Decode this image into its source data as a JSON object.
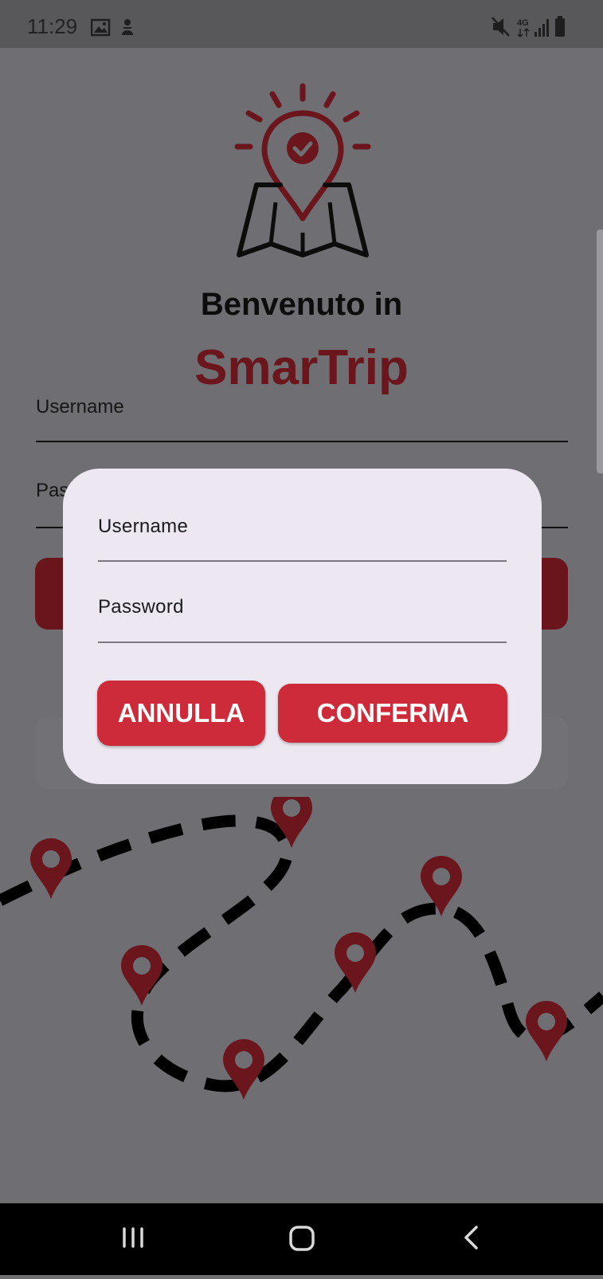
{
  "status_bar": {
    "time": "11:29",
    "left_icons": [
      "image-icon",
      "notification-icon"
    ],
    "right_icons": [
      "mute-icon",
      "network-4g-icon",
      "signal-icon",
      "battery-icon"
    ],
    "network_label": "4G"
  },
  "main": {
    "welcome_text": "Benvenuto in",
    "brand_name": "SmarTrip",
    "username_label": "Username",
    "password_label_partial": "Pas"
  },
  "dialog": {
    "username_label": "Username",
    "username_value": "",
    "password_label": "Password",
    "password_value": "",
    "cancel_label": "ANNULLA",
    "confirm_label": "CONFERMA"
  },
  "nav_bar": {
    "items": [
      "recent-apps-icon",
      "home-icon",
      "back-icon"
    ]
  },
  "colors": {
    "brand": "#6b151c",
    "accent": "#cd2a3a",
    "dialog_bg": "#ece7f0",
    "scrim": "#6e6e73"
  }
}
